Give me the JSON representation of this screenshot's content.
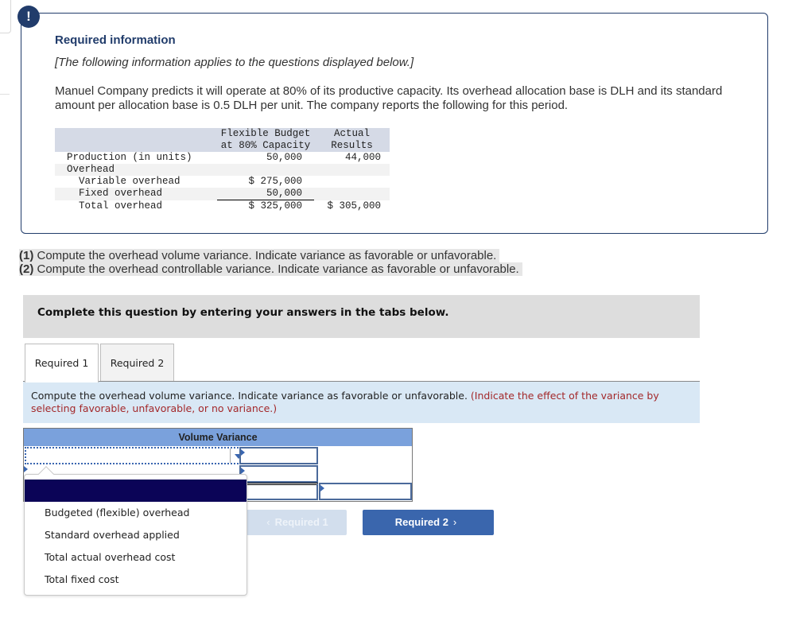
{
  "info": {
    "badge": "!",
    "title": "Required information",
    "subtitle": "[The following information applies to the questions displayed below.]",
    "body": "Manuel Company predicts it will operate at 80% of its productive capacity. Its overhead allocation base is DLH and its standard amount per allocation base is 0.5 DLH per unit. The company reports the following for this period."
  },
  "data_table": {
    "headers": [
      "",
      "Flexible Budget\nat 80% Capacity",
      "Actual\nResults"
    ],
    "rows": [
      {
        "label": "Production (in units)",
        "budget": "50,000",
        "actual": "44,000"
      },
      {
        "label": "Overhead",
        "budget": "",
        "actual": ""
      },
      {
        "label": "Variable overhead",
        "budget": "$ 275,000",
        "actual": ""
      },
      {
        "label": "Fixed overhead",
        "budget": "50,000",
        "actual": ""
      },
      {
        "label": "Total overhead",
        "budget": "$ 325,000",
        "actual": "$ 305,000"
      }
    ]
  },
  "questions": [
    {
      "num": "(1)",
      "text": " Compute the overhead volume variance. Indicate variance as favorable or unfavorable."
    },
    {
      "num": "(2)",
      "text": " Compute the overhead controllable variance. Indicate variance as favorable or unfavorable."
    }
  ],
  "complete_prompt": "Complete this question by entering your answers in the tabs below.",
  "tabs": [
    {
      "label": "Required 1",
      "active": true
    },
    {
      "label": "Required 2",
      "active": false
    }
  ],
  "instruction": {
    "main": "Compute the overhead volume variance. Indicate variance as favorable or unfavorable. ",
    "hint": "(Indicate the effect of the variance by selecting favorable, unfavorable, or no variance.)"
  },
  "answer_table": {
    "title": "Volume Variance",
    "dropdown_value": "",
    "dropdown_options": [
      "",
      "Budgeted (flexible) overhead",
      "Standard overhead applied",
      "Total actual overhead cost",
      "Total fixed cost"
    ],
    "inputs": [
      "",
      "",
      "",
      ""
    ]
  },
  "nav": {
    "prev_label": "Required 1",
    "next_label": "Required 2",
    "prev_icon": "chevron-left-icon",
    "next_icon": "chevron-right-icon"
  },
  "colors": {
    "brand_navy": "#213c6b",
    "header_blue": "#7aa1dc",
    "button_blue": "#3a66ad",
    "hint_red": "#a3282a",
    "selected_option": "#0b0457"
  }
}
